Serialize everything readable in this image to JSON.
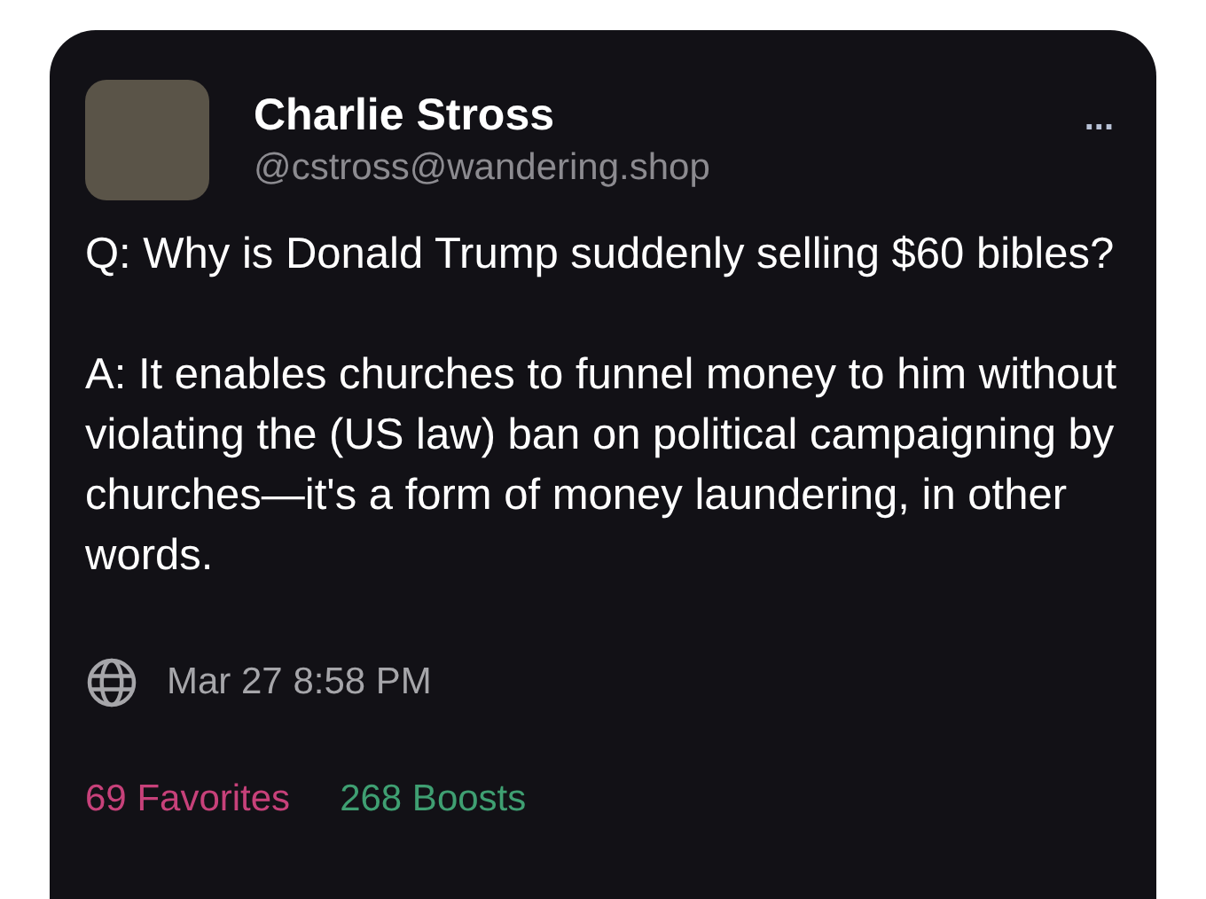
{
  "post": {
    "author": "Charlie Stross",
    "handle": "@cstross@wandering.shop",
    "more": "...",
    "paragraphs": [
      "Q: Why is Donald Trump suddenly selling $60 bibles?",
      "A: It enables churches to funnel money to him without violating the (US law) ban on political campaigning by churches—it's a form of money laundering, in other words."
    ],
    "timestamp": "Mar 27 8:58 PM",
    "stats": [
      {
        "label": "69 Favorites",
        "color": "#c7417a"
      },
      {
        "label": "268 Boosts",
        "color": "#3f9f72"
      }
    ]
  }
}
